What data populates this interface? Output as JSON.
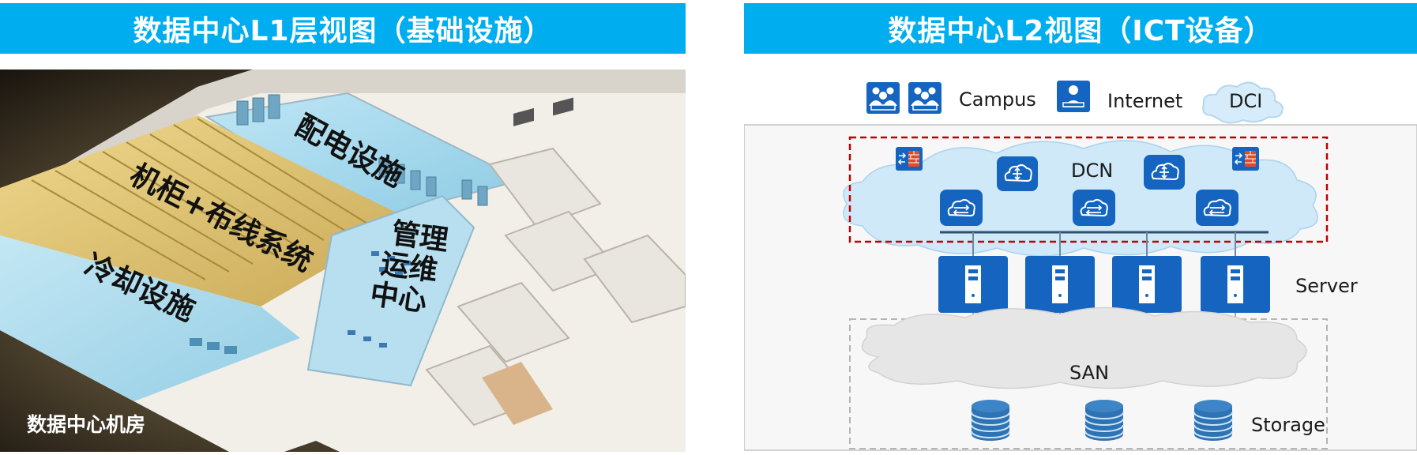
{
  "left": {
    "title": "数据中心L1层视图（基础设施）",
    "zones": {
      "power": "配电设施",
      "rack": "机柜+布线系统",
      "cooling": "冷却设施",
      "ops_line1": "管理",
      "ops_line2": "运维",
      "ops_line3": "中心"
    },
    "caption": "数据中心机房"
  },
  "right": {
    "title": "数据中心L2视图（ICT设备）",
    "labels": {
      "campus": "Campus",
      "internet": "Internet",
      "dci": "DCI",
      "dcn": "DCN",
      "server": "Server",
      "san": "SAN",
      "storage": "Storage"
    }
  },
  "colors": {
    "banner": "#00aeef",
    "device_blue": "#1565c0",
    "dcn_border": "#c00000",
    "cloud": "#cfe9f8",
    "san_cloud": "#e6e6e6"
  },
  "icons": [
    "campus-user-group-icon",
    "internet-user-icon",
    "firewall-icon",
    "router-icon",
    "switch-icon",
    "server-icon",
    "database-icon"
  ]
}
